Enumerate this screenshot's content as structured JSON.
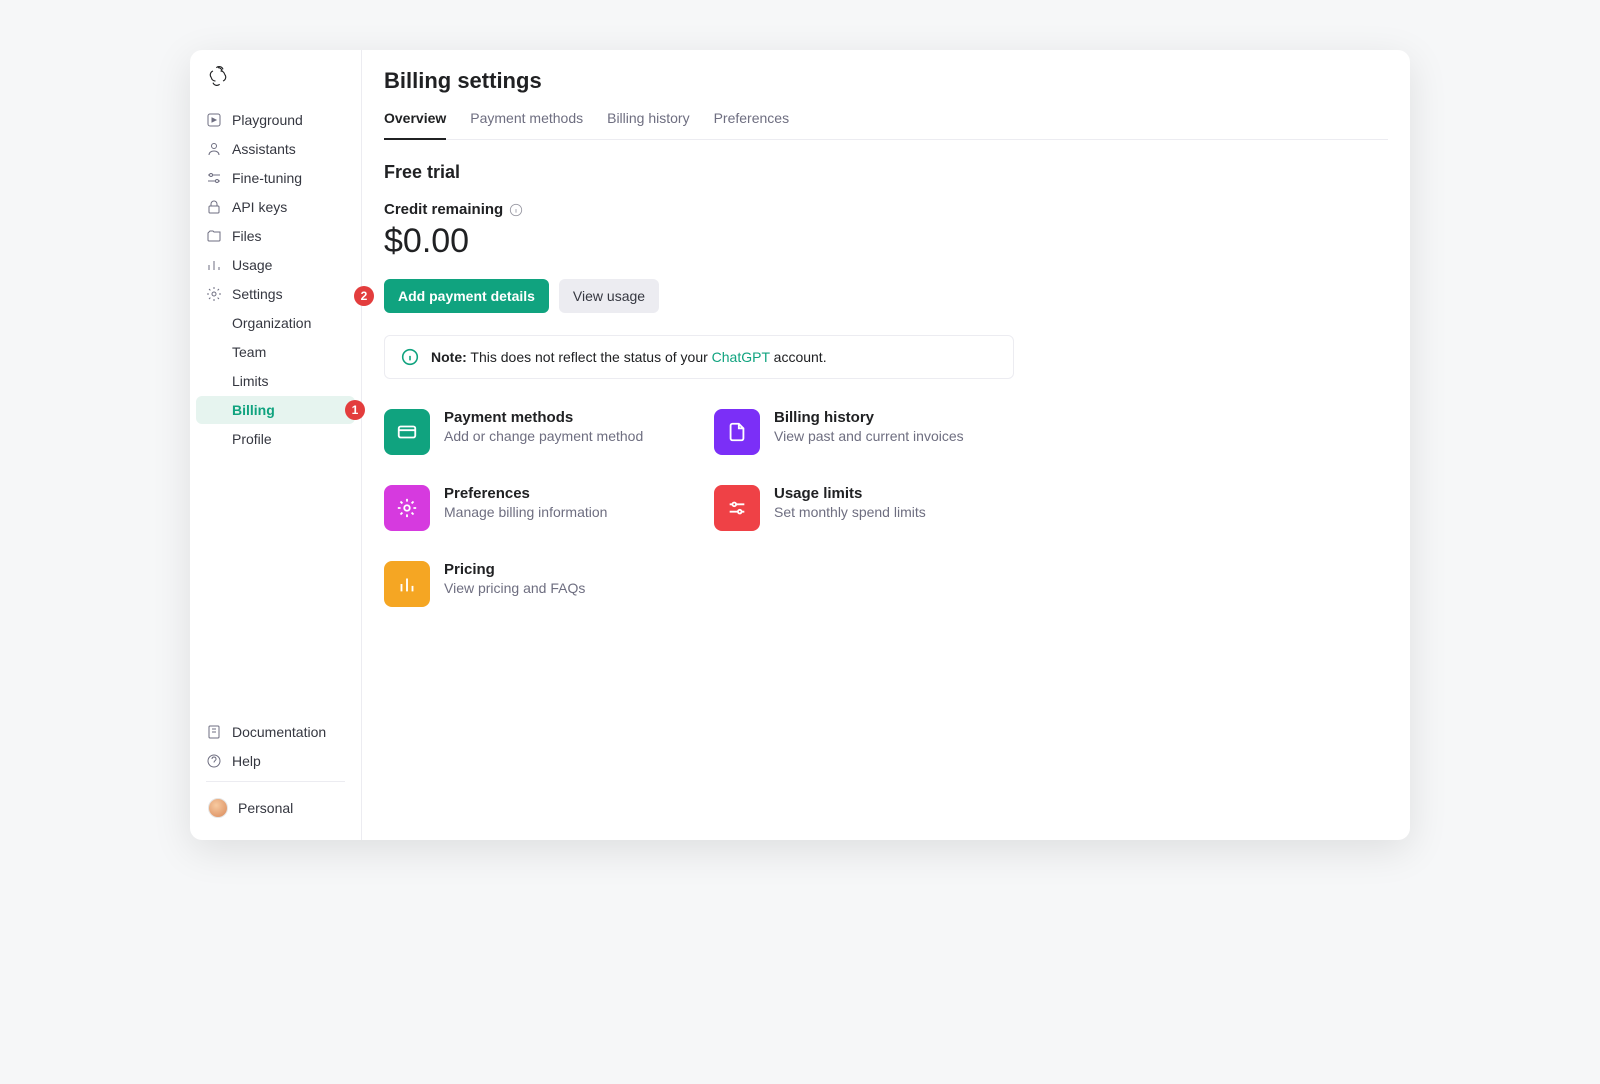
{
  "sidebar": {
    "items": [
      {
        "label": "Playground"
      },
      {
        "label": "Assistants"
      },
      {
        "label": "Fine-tuning"
      },
      {
        "label": "API keys"
      },
      {
        "label": "Files"
      },
      {
        "label": "Usage"
      },
      {
        "label": "Settings"
      }
    ],
    "settings_sub": [
      {
        "label": "Organization"
      },
      {
        "label": "Team"
      },
      {
        "label": "Limits"
      },
      {
        "label": "Billing"
      },
      {
        "label": "Profile"
      }
    ],
    "bottom": [
      {
        "label": "Documentation"
      },
      {
        "label": "Help"
      }
    ],
    "profile": "Personal"
  },
  "header": {
    "title": "Billing settings",
    "tabs": [
      {
        "label": "Overview"
      },
      {
        "label": "Payment methods"
      },
      {
        "label": "Billing history"
      },
      {
        "label": "Preferences"
      }
    ]
  },
  "overview": {
    "trial_title": "Free trial",
    "credit_label": "Credit remaining",
    "amount": "$0.00",
    "add_payment_btn": "Add payment details",
    "view_usage_btn": "View usage",
    "note_prefix": "Note:",
    "note_text_before": " This does not reflect the status of your ",
    "note_link": "ChatGPT",
    "note_text_after": " account."
  },
  "annotations": {
    "billing": "1",
    "add_payment": "2"
  },
  "cards": [
    {
      "title": "Payment methods",
      "desc": "Add or change payment method",
      "color": "ci-green",
      "icon": "card"
    },
    {
      "title": "Billing history",
      "desc": "View past and current invoices",
      "color": "ci-purple",
      "icon": "file"
    },
    {
      "title": "Preferences",
      "desc": "Manage billing information",
      "color": "ci-pink",
      "icon": "gear"
    },
    {
      "title": "Usage limits",
      "desc": "Set monthly spend limits",
      "color": "ci-red",
      "icon": "sliders"
    },
    {
      "title": "Pricing",
      "desc": "View pricing and FAQs",
      "color": "ci-orange",
      "icon": "chart"
    }
  ]
}
